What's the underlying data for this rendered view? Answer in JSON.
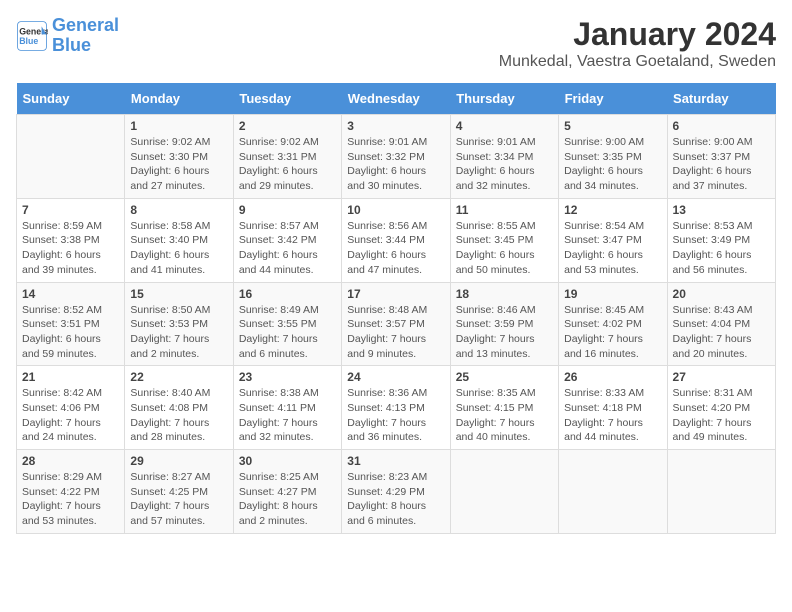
{
  "header": {
    "logo_line1": "General",
    "logo_line2": "Blue",
    "title": "January 2024",
    "subtitle": "Munkedal, Vaestra Goetaland, Sweden"
  },
  "days_of_week": [
    "Sunday",
    "Monday",
    "Tuesday",
    "Wednesday",
    "Thursday",
    "Friday",
    "Saturday"
  ],
  "weeks": [
    [
      {
        "day": "",
        "info": ""
      },
      {
        "day": "1",
        "info": "Sunrise: 9:02 AM\nSunset: 3:30 PM\nDaylight: 6 hours\nand 27 minutes."
      },
      {
        "day": "2",
        "info": "Sunrise: 9:02 AM\nSunset: 3:31 PM\nDaylight: 6 hours\nand 29 minutes."
      },
      {
        "day": "3",
        "info": "Sunrise: 9:01 AM\nSunset: 3:32 PM\nDaylight: 6 hours\nand 30 minutes."
      },
      {
        "day": "4",
        "info": "Sunrise: 9:01 AM\nSunset: 3:34 PM\nDaylight: 6 hours\nand 32 minutes."
      },
      {
        "day": "5",
        "info": "Sunrise: 9:00 AM\nSunset: 3:35 PM\nDaylight: 6 hours\nand 34 minutes."
      },
      {
        "day": "6",
        "info": "Sunrise: 9:00 AM\nSunset: 3:37 PM\nDaylight: 6 hours\nand 37 minutes."
      }
    ],
    [
      {
        "day": "7",
        "info": "Sunrise: 8:59 AM\nSunset: 3:38 PM\nDaylight: 6 hours\nand 39 minutes."
      },
      {
        "day": "8",
        "info": "Sunrise: 8:58 AM\nSunset: 3:40 PM\nDaylight: 6 hours\nand 41 minutes."
      },
      {
        "day": "9",
        "info": "Sunrise: 8:57 AM\nSunset: 3:42 PM\nDaylight: 6 hours\nand 44 minutes."
      },
      {
        "day": "10",
        "info": "Sunrise: 8:56 AM\nSunset: 3:44 PM\nDaylight: 6 hours\nand 47 minutes."
      },
      {
        "day": "11",
        "info": "Sunrise: 8:55 AM\nSunset: 3:45 PM\nDaylight: 6 hours\nand 50 minutes."
      },
      {
        "day": "12",
        "info": "Sunrise: 8:54 AM\nSunset: 3:47 PM\nDaylight: 6 hours\nand 53 minutes."
      },
      {
        "day": "13",
        "info": "Sunrise: 8:53 AM\nSunset: 3:49 PM\nDaylight: 6 hours\nand 56 minutes."
      }
    ],
    [
      {
        "day": "14",
        "info": "Sunrise: 8:52 AM\nSunset: 3:51 PM\nDaylight: 6 hours\nand 59 minutes."
      },
      {
        "day": "15",
        "info": "Sunrise: 8:50 AM\nSunset: 3:53 PM\nDaylight: 7 hours\nand 2 minutes."
      },
      {
        "day": "16",
        "info": "Sunrise: 8:49 AM\nSunset: 3:55 PM\nDaylight: 7 hours\nand 6 minutes."
      },
      {
        "day": "17",
        "info": "Sunrise: 8:48 AM\nSunset: 3:57 PM\nDaylight: 7 hours\nand 9 minutes."
      },
      {
        "day": "18",
        "info": "Sunrise: 8:46 AM\nSunset: 3:59 PM\nDaylight: 7 hours\nand 13 minutes."
      },
      {
        "day": "19",
        "info": "Sunrise: 8:45 AM\nSunset: 4:02 PM\nDaylight: 7 hours\nand 16 minutes."
      },
      {
        "day": "20",
        "info": "Sunrise: 8:43 AM\nSunset: 4:04 PM\nDaylight: 7 hours\nand 20 minutes."
      }
    ],
    [
      {
        "day": "21",
        "info": "Sunrise: 8:42 AM\nSunset: 4:06 PM\nDaylight: 7 hours\nand 24 minutes."
      },
      {
        "day": "22",
        "info": "Sunrise: 8:40 AM\nSunset: 4:08 PM\nDaylight: 7 hours\nand 28 minutes."
      },
      {
        "day": "23",
        "info": "Sunrise: 8:38 AM\nSunset: 4:11 PM\nDaylight: 7 hours\nand 32 minutes."
      },
      {
        "day": "24",
        "info": "Sunrise: 8:36 AM\nSunset: 4:13 PM\nDaylight: 7 hours\nand 36 minutes."
      },
      {
        "day": "25",
        "info": "Sunrise: 8:35 AM\nSunset: 4:15 PM\nDaylight: 7 hours\nand 40 minutes."
      },
      {
        "day": "26",
        "info": "Sunrise: 8:33 AM\nSunset: 4:18 PM\nDaylight: 7 hours\nand 44 minutes."
      },
      {
        "day": "27",
        "info": "Sunrise: 8:31 AM\nSunset: 4:20 PM\nDaylight: 7 hours\nand 49 minutes."
      }
    ],
    [
      {
        "day": "28",
        "info": "Sunrise: 8:29 AM\nSunset: 4:22 PM\nDaylight: 7 hours\nand 53 minutes."
      },
      {
        "day": "29",
        "info": "Sunrise: 8:27 AM\nSunset: 4:25 PM\nDaylight: 7 hours\nand 57 minutes."
      },
      {
        "day": "30",
        "info": "Sunrise: 8:25 AM\nSunset: 4:27 PM\nDaylight: 8 hours\nand 2 minutes."
      },
      {
        "day": "31",
        "info": "Sunrise: 8:23 AM\nSunset: 4:29 PM\nDaylight: 8 hours\nand 6 minutes."
      },
      {
        "day": "",
        "info": ""
      },
      {
        "day": "",
        "info": ""
      },
      {
        "day": "",
        "info": ""
      }
    ]
  ]
}
